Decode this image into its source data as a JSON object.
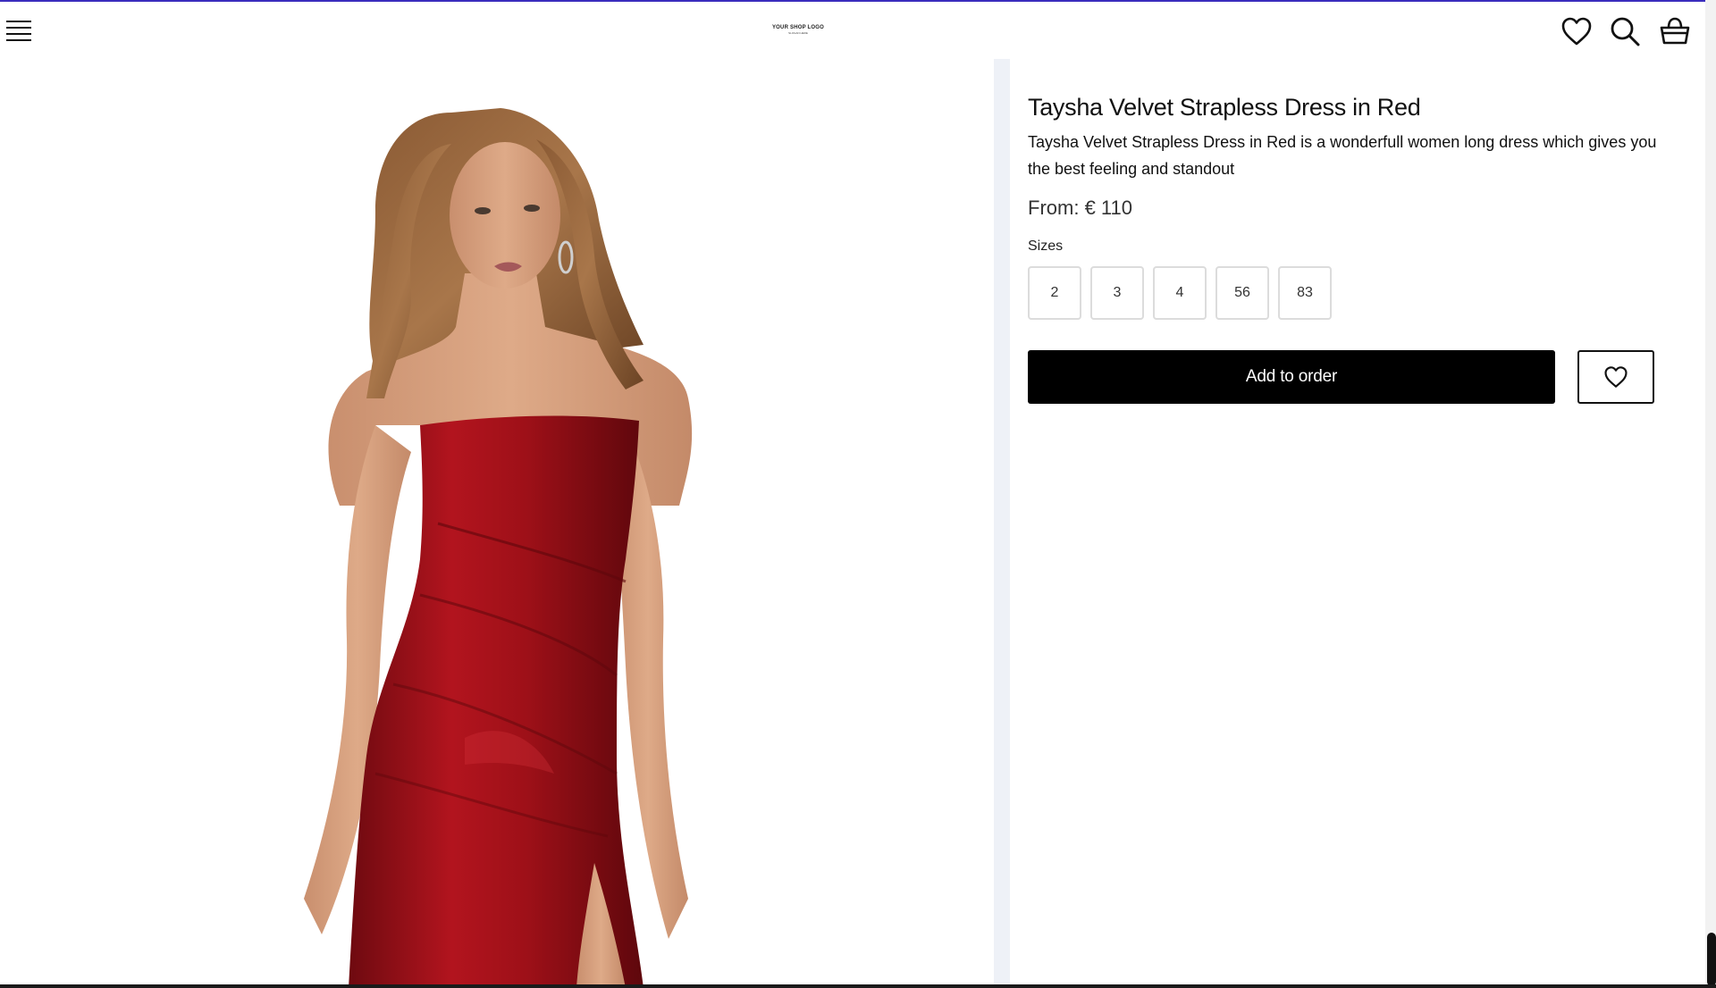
{
  "theme": {
    "accent": "#3a2dbd",
    "button_bg": "#000000",
    "button_text": "#ffffff",
    "dress_red": "#9e1018",
    "divider": "#eef1f7"
  },
  "header": {
    "menu_icon": "hamburger-menu-icon",
    "logo_text": "YOUR SHOP LOGO",
    "logo_subtext": "SLOGAN HERE",
    "icons": [
      "heart-icon",
      "search-icon",
      "shopping-basket-icon"
    ]
  },
  "product": {
    "title": "Taysha Velvet Strapless Dress in Red",
    "description": "Taysha Velvet Strapless Dress in Red is a wonderfull women long dress which gives you the best feeling and standout",
    "price_prefix": "From:",
    "price_value": "€ 110",
    "sizes_label": "Sizes",
    "sizes": [
      "2",
      "3",
      "4",
      "56",
      "83"
    ],
    "add_button_label": "Add to order",
    "wishlist_icon": "heart-icon",
    "image_subject": "model-in-red-velvet-strapless-dress"
  }
}
